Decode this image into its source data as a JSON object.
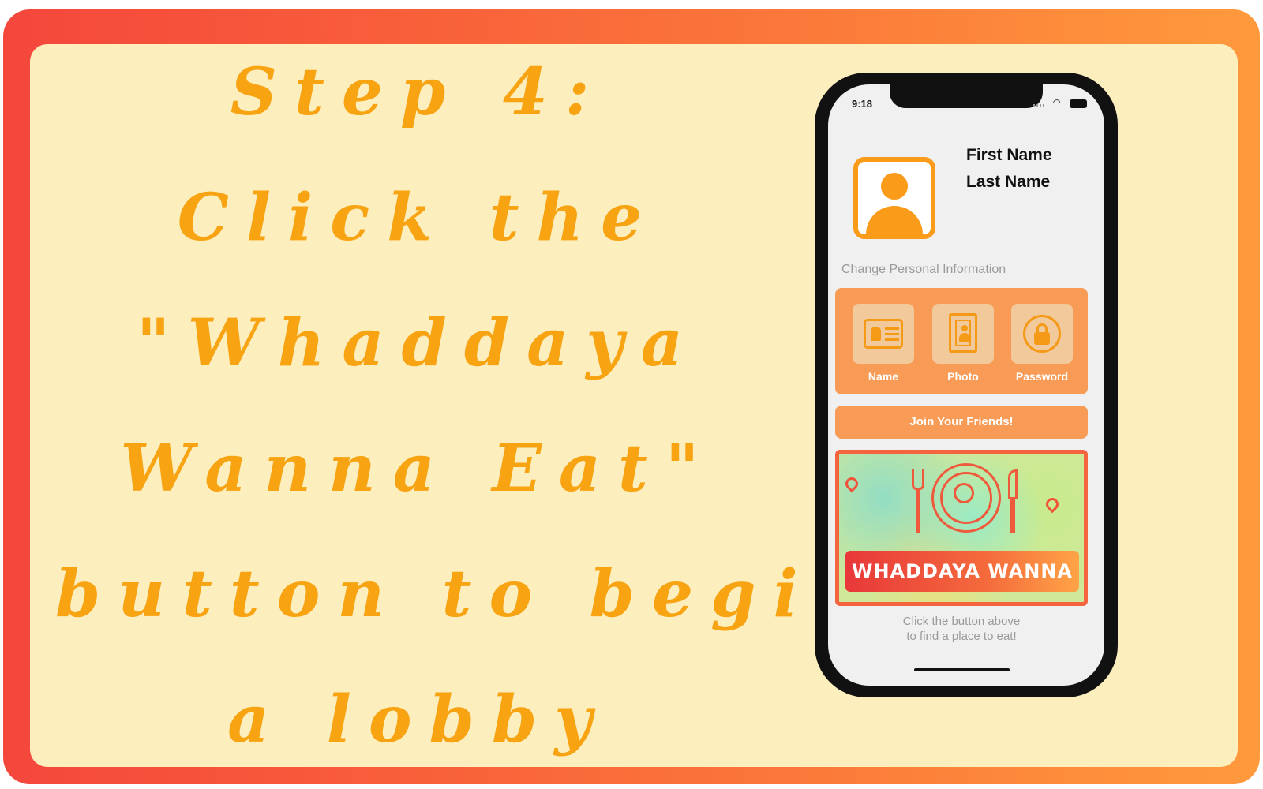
{
  "instruction": {
    "lines": [
      "Step 4:",
      "Click the",
      "\"Whaddaya",
      "Wanna Eat\"",
      "button to begin",
      "a lobby"
    ]
  },
  "phone": {
    "status_time": "9:18",
    "profile": {
      "first_name": "First Name",
      "last_name": "Last Name"
    },
    "section_label": "Change Personal Information",
    "options": [
      {
        "label": "Name",
        "icon": "id-card-icon"
      },
      {
        "label": "Photo",
        "icon": "portrait-icon"
      },
      {
        "label": "Password",
        "icon": "lock-icon"
      }
    ],
    "join_button_label": "Join Your Friends!",
    "main_button_label": "WHADDAYA WANNA EAT?",
    "hint_lines": [
      "Click the button above",
      "to find a place to eat!"
    ]
  },
  "colors": {
    "accent_orange": "#fa9b1a",
    "panel_cream": "#fdeebe",
    "frame_red": "#f4473c",
    "button_orange": "#f89b57",
    "instruction_text": "#f7a312"
  }
}
